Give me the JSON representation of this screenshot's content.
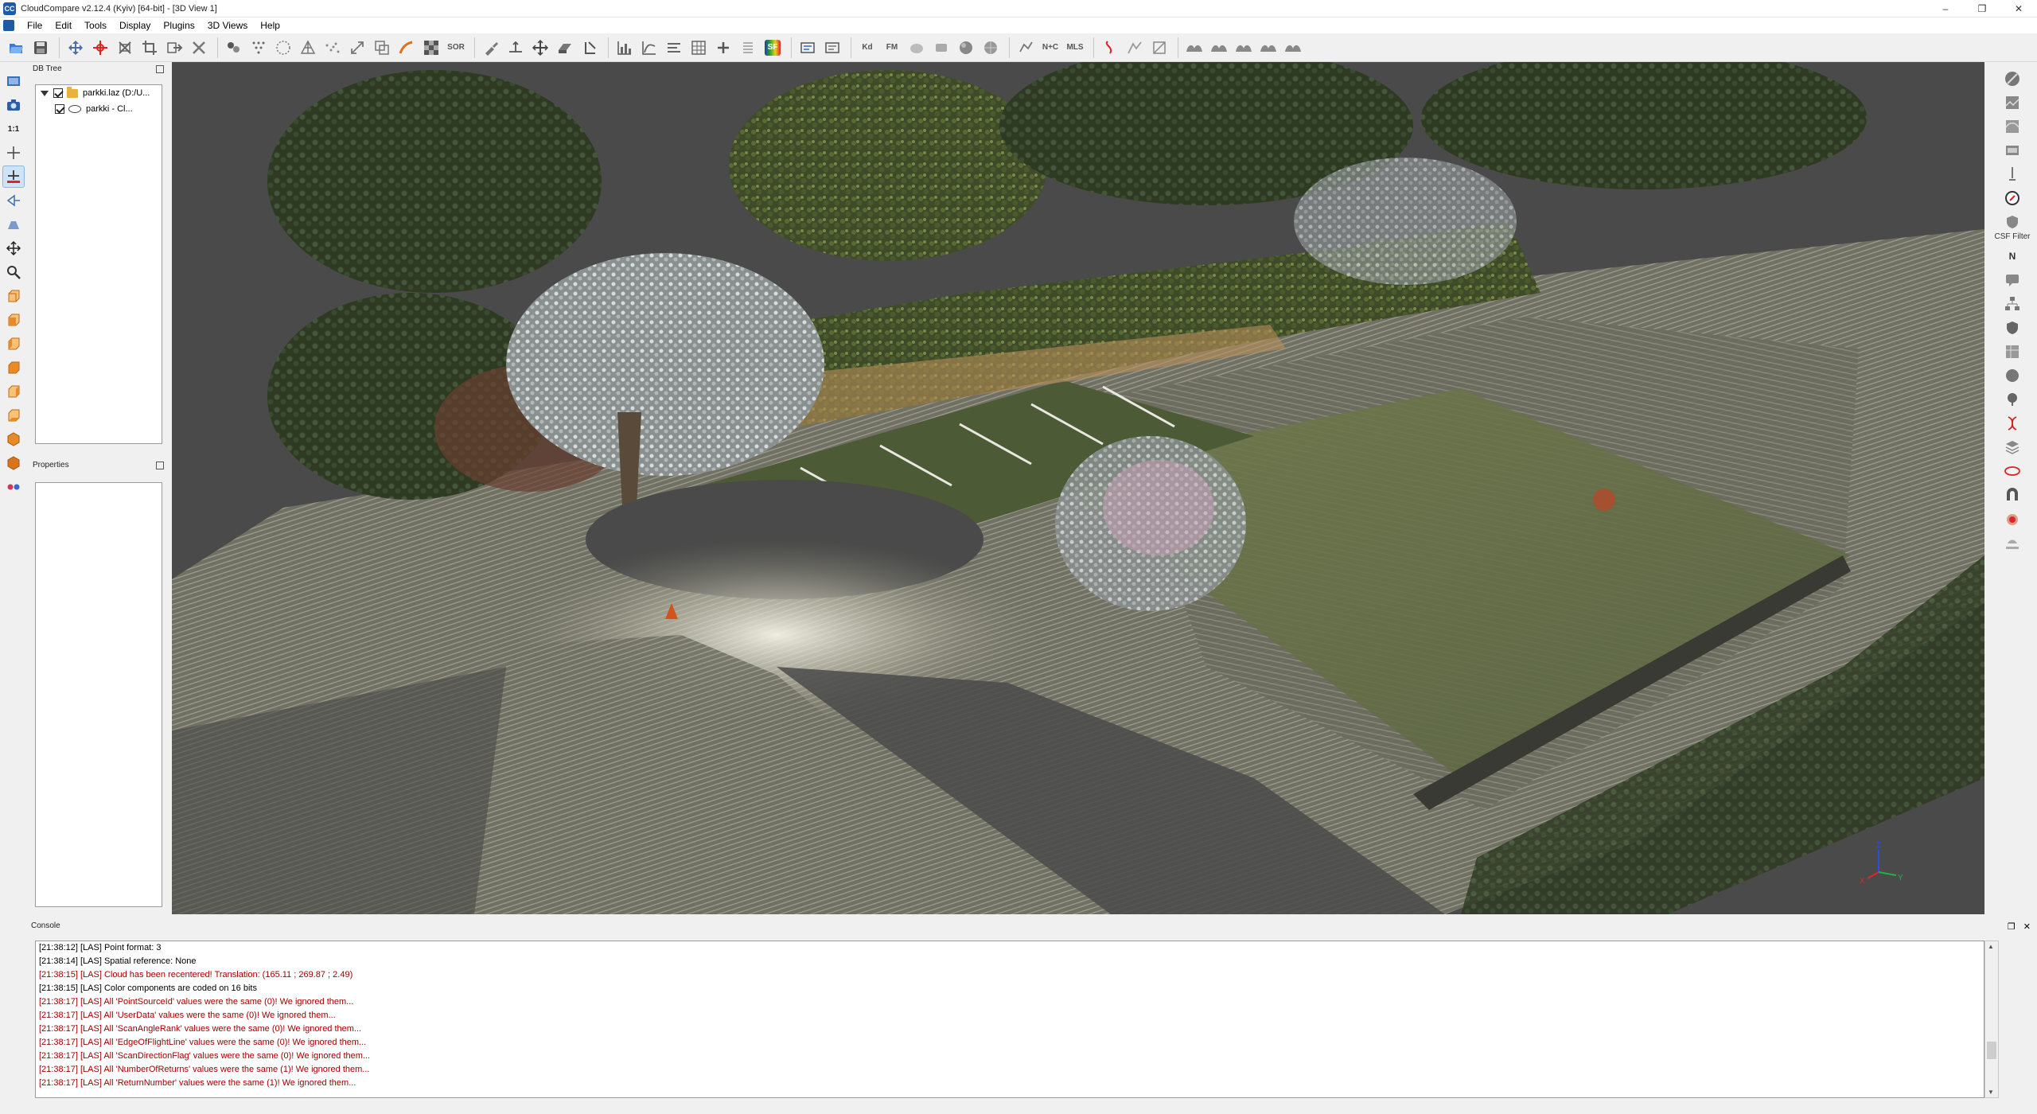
{
  "window": {
    "title": "CloudCompare v2.12.4 (Kyiv) [64-bit] - [3D View 1]",
    "minimize": "–",
    "maximize": "❐",
    "close": "✕"
  },
  "menu": {
    "items": [
      "File",
      "Edit",
      "Tools",
      "Display",
      "Plugins",
      "3D Views",
      "Help"
    ]
  },
  "toolbar": {
    "sf_label": "SF",
    "sor_label": "SOR",
    "kd_label": "Kd",
    "fm_label": "FM",
    "n_c_label": "N+C",
    "mls_label": "MLS"
  },
  "dbtree": {
    "title": "DB Tree",
    "root_label": "parkki.laz (D:/U...",
    "child_label": "parkki - Cl..."
  },
  "properties": {
    "title": "Properties"
  },
  "right_toolbar": {
    "csf_label": "CSF Filter",
    "north_label": "N"
  },
  "console": {
    "title": "Console",
    "lines": [
      {
        "text": "[21:38:12] [LAS] Point format: 3",
        "level": "info"
      },
      {
        "text": "[21:38:14] [LAS] Spatial reference: None",
        "level": "info"
      },
      {
        "text": "[21:38:15] [LAS] Cloud has been recentered! Translation: (165.11 ; 269.87 ; 2.49)",
        "level": "warn"
      },
      {
        "text": "[21:38:15] [LAS] Color components are coded on 16 bits",
        "level": "info"
      },
      {
        "text": "[21:38:17] [LAS] All 'PointSourceId' values were the same (0)! We ignored them...",
        "level": "warn"
      },
      {
        "text": "[21:38:17] [LAS] All 'UserData' values were the same (0)! We ignored them...",
        "level": "warn"
      },
      {
        "text": "[21:38:17] [LAS] All 'ScanAngleRank' values were the same (0)! We ignored them...",
        "level": "warn"
      },
      {
        "text": "[21:38:17] [LAS] All 'EdgeOfFlightLine' values were the same (0)! We ignored them...",
        "level": "warn"
      },
      {
        "text": "[21:38:17] [LAS] All 'ScanDirectionFlag' values were the same (0)! We ignored them...",
        "level": "warn"
      },
      {
        "text": "[21:38:17] [LAS] All 'NumberOfReturns' values were the same (1)! We ignored them...",
        "level": "warn"
      },
      {
        "text": "[21:38:17] [LAS] All 'ReturnNumber' values were the same (1)! We ignored them...",
        "level": "warn"
      }
    ]
  },
  "view3d": {
    "axis_labels": {
      "x": "X",
      "y": "Y",
      "z": "Z"
    },
    "colors": {
      "background": "#4a4a4a",
      "vegetation": "#4b5a2c",
      "pavement": "#6e6e62",
      "highlight": "#d9d6c8"
    }
  }
}
